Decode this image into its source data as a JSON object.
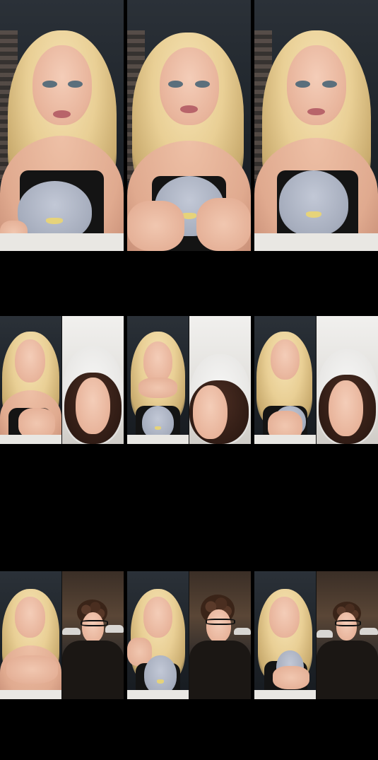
{
  "image_description_type": "screenshot-grid",
  "grid": {
    "columns": 3,
    "rows": 3
  },
  "rows": [
    {
      "kind": "single",
      "frames": [
        {
          "scene": "girl-with-penguin"
        },
        {
          "scene": "girl-with-penguin-hands"
        },
        {
          "scene": "girl-with-penguin"
        }
      ]
    },
    {
      "kind": "split",
      "frames": [
        {
          "left": "girl-with-penguin",
          "right": "girl-in-hood"
        },
        {
          "left": "girl-with-penguin",
          "right": "girl-in-hood"
        },
        {
          "left": "girl-with-penguin",
          "right": "girl-in-hood"
        }
      ]
    },
    {
      "kind": "split",
      "frames": [
        {
          "left": "girl-with-penguin",
          "right": "boy-with-glasses"
        },
        {
          "left": "girl-with-penguin",
          "right": "boy-with-glasses"
        },
        {
          "left": "girl-with-penguin",
          "right": "boy-with-glasses"
        }
      ]
    }
  ],
  "colors": {
    "background": "#000000"
  }
}
